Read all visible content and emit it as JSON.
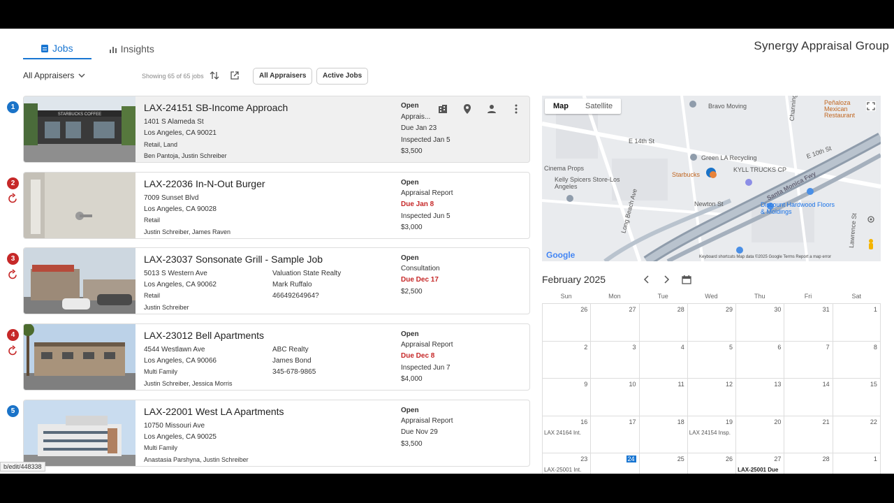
{
  "header": {
    "tabs": [
      {
        "label": "Jobs"
      },
      {
        "label": "Insights"
      }
    ],
    "brand": "Synergy Appraisal Group"
  },
  "toolbar": {
    "filter": "All Appraisers",
    "showing": "Showing 65 of 65 jobs",
    "chips": [
      "All Appraisers",
      "Active Jobs"
    ]
  },
  "jobs": [
    {
      "num": "1",
      "badge": "blue",
      "sync": false,
      "title": "LAX-24151 SB-Income Approach",
      "address": "1401 S Alameda St",
      "city": "Los Angeles, CA 90021",
      "type": "Retail, Land",
      "people": "Ben Pantoja, Justin Schreiber",
      "client": "",
      "contact": "",
      "phone": "",
      "status": "Open",
      "report": "Apprais...",
      "due": "Due Jan 23",
      "due_red": false,
      "inspected": "Inspected Jan 5",
      "fee": "$3,500"
    },
    {
      "num": "2",
      "badge": "red",
      "sync": true,
      "title": "LAX-22036 In-N-Out Burger",
      "address": "7009 Sunset Blvd",
      "city": "Los Angeles, CA 90028",
      "type": "Retail",
      "people": "Justin Schreiber, James Raven",
      "client": "",
      "contact": "",
      "phone": "",
      "status": "Open",
      "report": "Appraisal Report",
      "due": "Due Jan 8",
      "due_red": true,
      "inspected": "Inspected Jun 5",
      "fee": "$3,000"
    },
    {
      "num": "3",
      "badge": "red",
      "sync": true,
      "title": "LAX-23037 Sonsonate Grill - Sample Job",
      "address": "5013 S Western Ave",
      "city": "Los Angeles, CA 90062",
      "type": "Retail",
      "people": "Justin Schreiber",
      "client": "Valuation State Realty",
      "contact": "Mark Ruffalo",
      "phone": "46649264964?",
      "status": "Open",
      "report": "Consultation",
      "due": "Due Dec 17",
      "due_red": true,
      "inspected": "",
      "fee": "$2,500"
    },
    {
      "num": "4",
      "badge": "red",
      "sync": true,
      "title": "LAX-23012 Bell Apartments",
      "address": "4544 Westlawn Ave",
      "city": "Los Angeles, CA 90066",
      "type": "Multi Family",
      "people": "Justin Schreiber, Jessica Morris",
      "client": "ABC Realty",
      "contact": "James Bond",
      "phone": "345-678-9865",
      "status": "Open",
      "report": "Appraisal Report",
      "due": "Due Dec 8",
      "due_red": true,
      "inspected": "Inspected Jun 7",
      "fee": "$4,000"
    },
    {
      "num": "5",
      "badge": "blue",
      "sync": false,
      "title": "LAX-22001 West LA Apartments",
      "address": "10750 Missouri Ave",
      "city": "Los Angeles, CA 90025",
      "type": "Multi Family",
      "people": "Anastasia Parshyna, Justin Schreiber",
      "client": "",
      "contact": "",
      "phone": "",
      "status": "Open",
      "report": "Appraisal Report",
      "due": "Due Nov 29",
      "due_red": false,
      "inspected": "",
      "fee": "$3,500"
    }
  ],
  "map": {
    "tabs": [
      "Map",
      "Satellite"
    ],
    "labels": {
      "bravo": "Bravo Moving",
      "penaloza": "Peñaloza Mexican Restaurant",
      "e14": "E 14th St",
      "green": "Green LA Recycling",
      "e10": "E 10th St",
      "cinema": "Cinema Props",
      "kyle": "KYLL TRUCKS CP",
      "starbucks": "Starbucks",
      "kelly": "Kelly Spicers Store-Los Angeles",
      "fwy": "Santa Monica Fwy",
      "newton": "Newton St",
      "discount": "Discount Hardwood Floors & Moldings",
      "longbeach": "Long Beach Ave",
      "channing": "Channing",
      "lawrence": "Lawrence St",
      "google": "Google",
      "footer": "Keyboard shortcuts   Map data ©2025 Google   Terms   Report a map error",
      "pin": "1"
    }
  },
  "calendar": {
    "title": "February 2025",
    "dows": [
      "Sun",
      "Mon",
      "Tue",
      "Wed",
      "Thu",
      "Fri",
      "Sat"
    ],
    "weeks": [
      [
        {
          "d": "26"
        },
        {
          "d": "27"
        },
        {
          "d": "28"
        },
        {
          "d": "29"
        },
        {
          "d": "30"
        },
        {
          "d": "31"
        },
        {
          "d": "1"
        }
      ],
      [
        {
          "d": "2"
        },
        {
          "d": "3"
        },
        {
          "d": "4"
        },
        {
          "d": "5"
        },
        {
          "d": "6"
        },
        {
          "d": "7"
        },
        {
          "d": "8"
        }
      ],
      [
        {
          "d": "9"
        },
        {
          "d": "10"
        },
        {
          "d": "11"
        },
        {
          "d": "12"
        },
        {
          "d": "13"
        },
        {
          "d": "14"
        },
        {
          "d": "15"
        }
      ],
      [
        {
          "d": "16",
          "ev": "LAX 24164  Int."
        },
        {
          "d": "17"
        },
        {
          "d": "18"
        },
        {
          "d": "19",
          "ev": "LAX 24154  Insp."
        },
        {
          "d": "20"
        },
        {
          "d": "21"
        },
        {
          "d": "22"
        }
      ],
      [
        {
          "d": "23",
          "ev": "LAX-25001  Int."
        },
        {
          "d": "24",
          "today": true
        },
        {
          "d": "25"
        },
        {
          "d": "26"
        },
        {
          "d": "27",
          "ev": "LAX-25001  Due",
          "dark": true
        },
        {
          "d": "28"
        },
        {
          "d": "1"
        }
      ]
    ]
  },
  "statusbar": "b/edit/448338",
  "colors": {
    "accent": "#1976d2",
    "red": "#c62828",
    "badge_blue": "#1a73c8"
  }
}
